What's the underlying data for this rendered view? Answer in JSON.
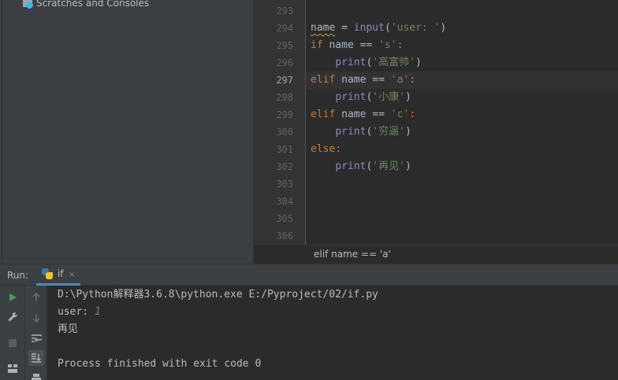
{
  "project_panel": {
    "tree_item_label": "Scratches and Consoles",
    "tree_item_icon": "scratches-icon"
  },
  "editor": {
    "line_numbers": [
      "293",
      "294",
      "295",
      "296",
      "297",
      "298",
      "299",
      "300",
      "301",
      "302",
      "303",
      "304",
      "305",
      "306"
    ],
    "current_line": "297",
    "code": {
      "l294_var": "name",
      "l294_eq": " = ",
      "l294_fn": "input",
      "l294_open": "(",
      "l294_str": "'user: '",
      "l294_close": ")",
      "l295_kw": "if",
      "l295_rest": " name == ",
      "l295_str": "'s'",
      "l295_colon": ":",
      "l296_indent": "    ",
      "l296_fn": "print",
      "l296_open": "(",
      "l296_str": "'高富帅'",
      "l296_close": ")",
      "l297_kw": "elif",
      "l297_rest": " name == ",
      "l297_str": "'a'",
      "l297_colon": ":",
      "l298_indent": "    ",
      "l298_fn": "print",
      "l298_open": "(",
      "l298_str": "'小康'",
      "l298_close": ")",
      "l299_kw": "elif",
      "l299_rest": " name == ",
      "l299_str": "'c'",
      "l299_colon": ":",
      "l300_indent": "    ",
      "l300_fn": "print",
      "l300_open": "(",
      "l300_str": "'穷逼'",
      "l300_close": ")",
      "l301_kw": "else",
      "l301_colon": ":",
      "l302_indent": "    ",
      "l302_fn": "print",
      "l302_open": "(",
      "l302_str": "'再见'",
      "l302_close": ")"
    },
    "breadcrumb": "elif name == 'a'"
  },
  "run_window": {
    "title": "Run:",
    "tab_label": "if",
    "tab_close": "×",
    "tab_icon": "python-icon",
    "console": {
      "command": "D:\\Python解释器3.6.8\\python.exe E:/Pyproject/02/if.py",
      "prompt": "user: ",
      "user_input": "1",
      "output": "再见",
      "exit_message": "Process finished with exit code 0"
    }
  },
  "colors": {
    "keyword": "#cc7832",
    "builtin": "#8888c6",
    "string": "#6a8759",
    "accent": "#4a88c7",
    "run_green": "#499c54"
  }
}
